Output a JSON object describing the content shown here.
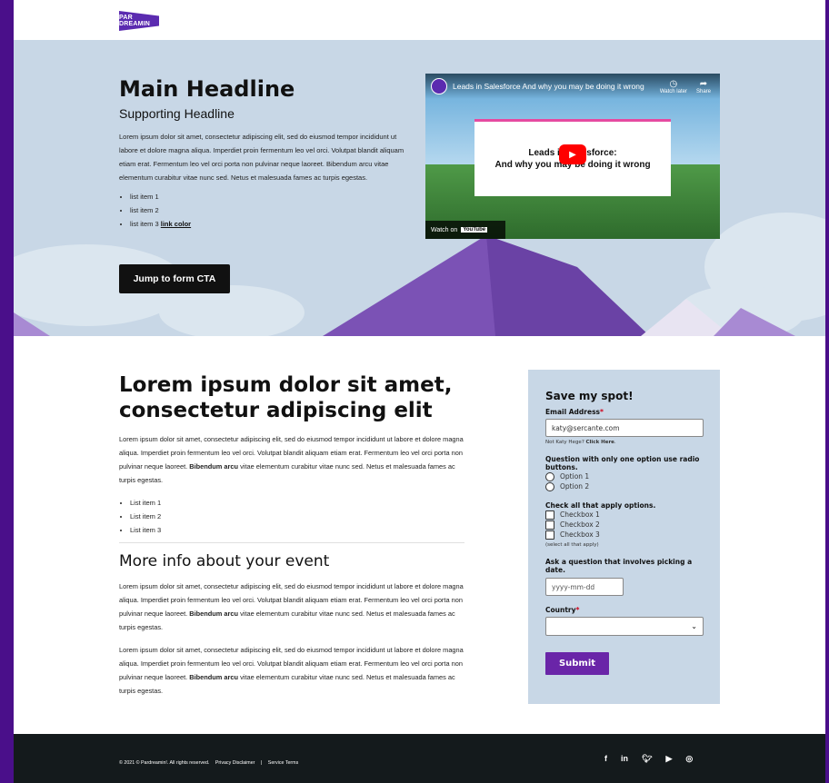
{
  "brand": {
    "logo_text": "PAR DREAMIN"
  },
  "hero": {
    "headline": "Main Headline",
    "subheadline": "Supporting Headline",
    "body": "Lorem ipsum dolor sit amet, consectetur adipiscing elit, sed do eiusmod tempor incididunt ut labore et dolore magna aliqua. Imperdiet proin fermentum leo vel orci. Volutpat blandit aliquam etiam erat. Fermentum leo vel orci porta non pulvinar neque laoreet. Bibendum arcu vitae elementum curabitur vitae nunc sed. Netus et malesuada fames ac turpis egestas.",
    "list": [
      "list item 1",
      "list item 2",
      "list item 3 "
    ],
    "link_text": "link color",
    "cta_label": "Jump to form CTA"
  },
  "video": {
    "title": "Leads in Salesforce And why you may be doing it wrong",
    "watch_later": "Watch later",
    "share": "Share",
    "card_line1": "Leads in Salesforce:",
    "card_line2": "And why you may be doing it wrong",
    "watch_on": "Watch on",
    "youtube": "YouTube"
  },
  "content": {
    "heading": "Lorem ipsum dolor sit amet, consectetur adipiscing elit",
    "para1_a": "Lorem ipsum dolor sit amet, consectetur adipiscing elit, sed do eiusmod tempor incididunt ut labore et dolore magna aliqua. Imperdiet proin fermentum leo vel orci. Volutpat blandit aliquam etiam erat. Fermentum leo vel orci porta non pulvinar neque laoreet. ",
    "bold": "Bibendum arcu",
    "para1_b": " vitae elementum curabitur vitae nunc sed. Netus et malesuada fames ac turpis egestas.",
    "list": [
      "List item 1",
      "List item 2",
      "List item 3"
    ],
    "subheading": "More info about your event",
    "para2_a": "Lorem ipsum dolor sit amet, consectetur adipiscing elit, sed do eiusmod tempor incididunt ut labore et dolore magna aliqua. Imperdiet proin fermentum leo vel orci. Volutpat blandit aliquam etiam erat. Fermentum leo vel orci porta non pulvinar neque laoreet. ",
    "para2_b": " vitae elementum curabitur vitae nunc sed. Netus et malesuada fames ac turpis egestas.",
    "para3_a": "Lorem ipsum dolor sit amet, consectetur adipiscing elit, sed do eiusmod tempor incididunt ut labore et dolore magna aliqua. Imperdiet proin fermentum leo vel orci. Volutpat blandit aliquam etiam erat. Fermentum leo vel orci porta non pulvinar neque laoreet. ",
    "para3_b": " vitae elementum curabitur vitae nunc sed. Netus et malesuada fames ac turpis egestas."
  },
  "form": {
    "title": "Save my spot!",
    "email_label": "Email Address",
    "email_value": "katy@sercante.com",
    "not_you": "Not Katy Hege? ",
    "click_here": "Click Here",
    "radio_question": "Question with only one option use radio buttons.",
    "radio_options": [
      "Option 1",
      "Option 2"
    ],
    "check_question": "Check all that apply options.",
    "check_options": [
      "Checkbox 1",
      "Checkbox 2",
      "Checkbox 3"
    ],
    "check_note": "(select all that apply)",
    "date_question": "Ask a question that involves picking a date.",
    "date_placeholder": "yyyy-mm-dd",
    "country_label": "Country",
    "submit_label": "Submit"
  },
  "footer": {
    "copyright": "© 2021 © Pardreamin!. All rights reserved.",
    "privacy": "Privacy Disclaimer",
    "sep": "|",
    "terms": "Service Terms",
    "social": [
      "f",
      "in",
      "t",
      "yt",
      "ig"
    ]
  },
  "colors": {
    "brand_purple": "#6a25a8",
    "hero_bg": "#c8d7e6",
    "footer_bg": "#141a1c",
    "frame": "#4a0f8a"
  }
}
